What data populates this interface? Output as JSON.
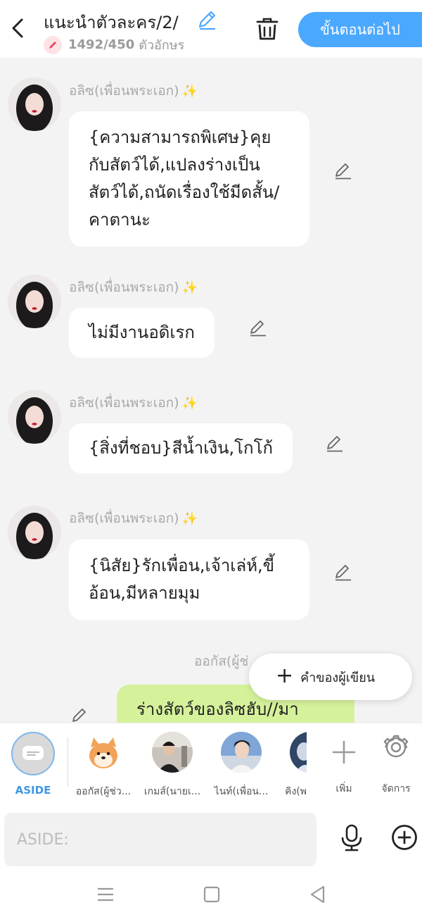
{
  "header": {
    "title": "แนะนำตัวละคร/2/",
    "counter": "1492/450",
    "counter_unit": "ตัวอักษร",
    "next_button": "ขั้นตอนต่อไป"
  },
  "messages": [
    {
      "sender": "อลิซ(เพื่อนพระเอก)",
      "text": "{ความสามารถพิเศษ}คุยกับสัตว์ได้,แปลงร่างเป็นสัตว์ได้,ถนัดเรื่องใช้มีดสั้น/คาตานะ"
    },
    {
      "sender": "อลิซ(เพื่อนพระเอก)",
      "text": "ไม่มีงานอดิเรก"
    },
    {
      "sender": "อลิซ(เพื่อนพระเอก)",
      "text": "{สิ่งที่ชอบ}สีน้ำเงิน,โกโก้"
    },
    {
      "sender": "อลิซ(เพื่อนพระเอก)",
      "text": "{นิสัย}รักเพื่อน,เจ้าเล่ห์,ขี้อ้อน,มีหลายมุม"
    },
    {
      "sender": "ออกัส(ผู้ช่",
      "text": "ร่างสัตว์ของลิซฮับ//มา"
    }
  ],
  "writer_note_button": "คำของผู้เขียน",
  "tray": {
    "aside_label": "ASIDE",
    "characters": [
      {
        "name": "ออกัส(ผู้ช่ว..."
      },
      {
        "name": "เกมส์(นายเ..."
      },
      {
        "name": "ไนท์(เพื่อน..."
      },
      {
        "name": "คิง(พ"
      }
    ],
    "add_label": "เพิ่ม",
    "manage_label": "จัดการ"
  },
  "input": {
    "placeholder": "ASIDE:"
  },
  "colors": {
    "accent": "#4aa8ff",
    "sent_bubble": "#d5f29b",
    "sparkle": "#f2c94c"
  },
  "icons": {
    "back": "chevron-left-icon",
    "title_edit": "pencil-icon",
    "trash": "trash-icon",
    "mic": "microphone-icon",
    "plus": "plus-circle-icon",
    "settings": "gear-icon"
  }
}
